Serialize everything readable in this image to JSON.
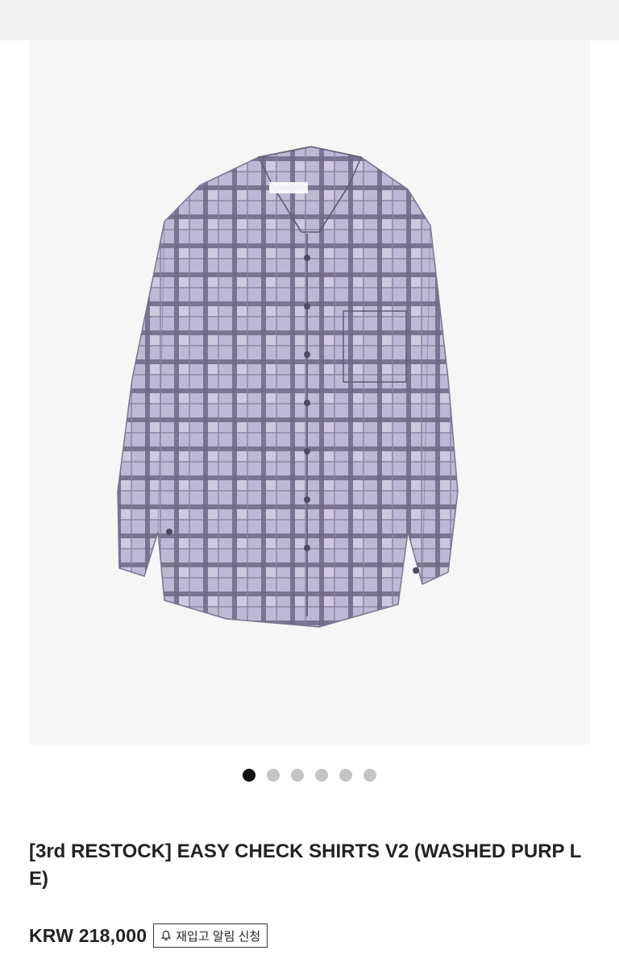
{
  "gallery": {
    "image_alt": "washed purple check shirt",
    "slide_count": 6,
    "active_index": 0,
    "colors": {
      "fabric": "#b9b4cf",
      "check_line": "#5b5670",
      "background": "#f6f6f6"
    }
  },
  "product": {
    "title": "[3rd RESTOCK] EASY CHECK SHIRTS V2 (WASHED PURP LE)",
    "price": "KRW 218,000",
    "restock_button": {
      "icon": "bell-icon",
      "label": "재입고 알림 신청"
    }
  }
}
